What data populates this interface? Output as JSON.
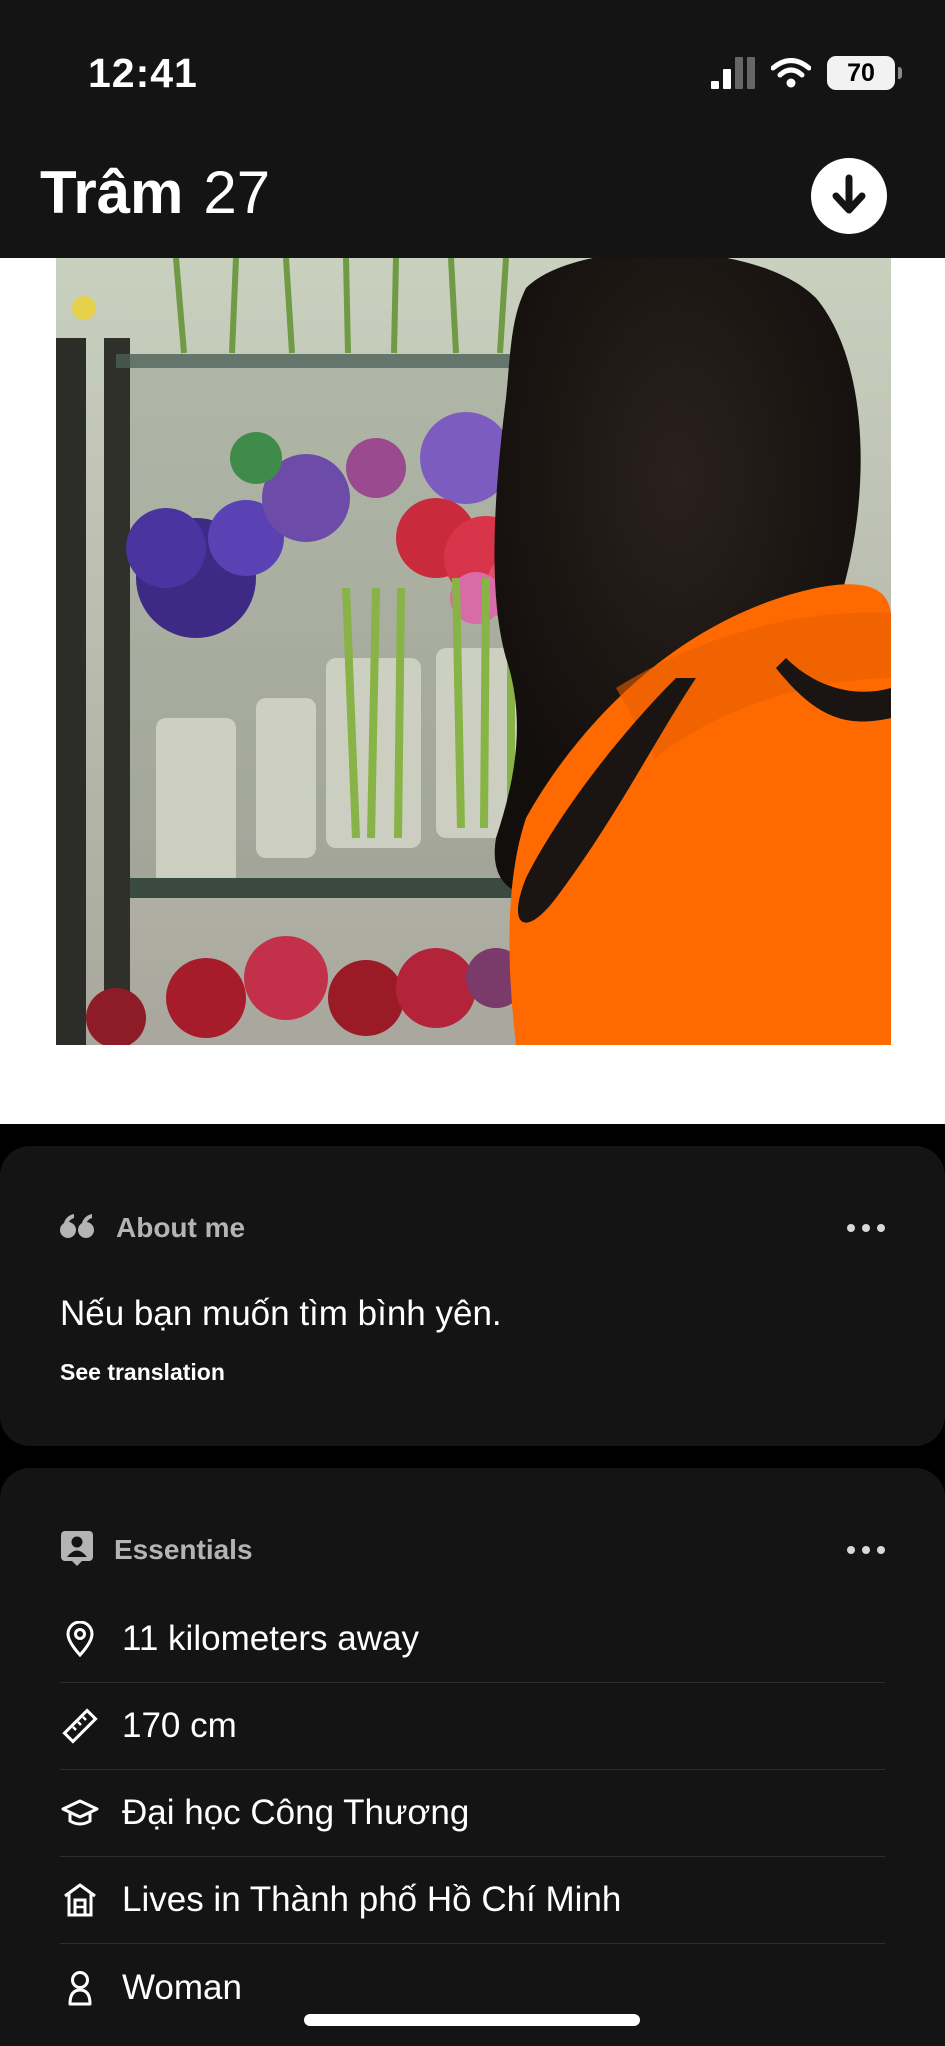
{
  "status_bar": {
    "time": "12:41",
    "battery": "70"
  },
  "profile": {
    "name": "Trâm",
    "age": "27"
  },
  "photo": {
    "description_icon": "profile-photo"
  },
  "about": {
    "header": "About me",
    "text": "Nếu bạn muốn tìm bình yên.",
    "see_translation": "See translation"
  },
  "essentials": {
    "header": "Essentials",
    "items": [
      {
        "icon": "location-pin-icon",
        "label": "11 kilometers away"
      },
      {
        "icon": "ruler-icon",
        "label": "170 cm"
      },
      {
        "icon": "graduation-cap-icon",
        "label": "Đại học Công Thương"
      },
      {
        "icon": "home-icon",
        "label": "Lives in Thành phố Hồ Chí Minh"
      },
      {
        "icon": "person-icon",
        "label": "Woman"
      }
    ]
  },
  "colors": {
    "background": "#000000",
    "card": "#141414",
    "sweater_orange": "#ff6a00"
  }
}
